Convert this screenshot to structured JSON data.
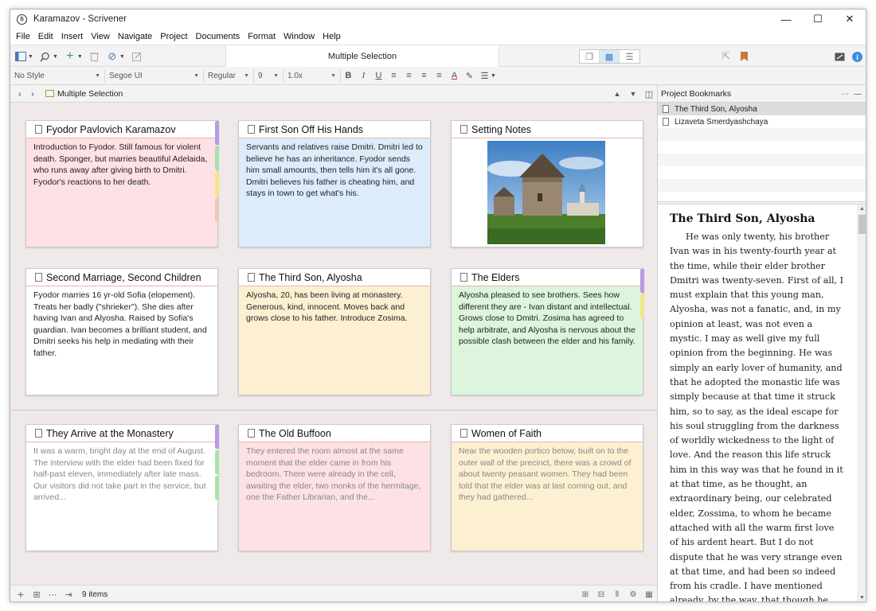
{
  "window": {
    "title": "Karamazov - Scrivener",
    "controls": {
      "minimize": "—",
      "maximize": "☐",
      "close": "✕"
    }
  },
  "menu": [
    "File",
    "Edit",
    "Insert",
    "View",
    "Navigate",
    "Project",
    "Documents",
    "Format",
    "Window",
    "Help"
  ],
  "toolbar": {
    "center_title": "Multiple Selection"
  },
  "format": {
    "style": "No Style",
    "font": "Segoe UI",
    "weight": "Regular",
    "size": "9",
    "spacing": "1.0x"
  },
  "breadcrumb": {
    "label": "Multiple Selection"
  },
  "cards": [
    {
      "title": "Fyodor Pavlovich  Karamazov",
      "body": "Introduction to Fyodor. Still famous for violent death. Sponger, but marries beautiful Adelaida, who runs away after giving birth to Dmitri. Fyodor's reactions to her death.",
      "color": "pink",
      "labels": [
        "#b89be0",
        "#a6e3a6",
        "#f4e58a",
        "#f0c9b5"
      ]
    },
    {
      "title": "First Son Off His Hands",
      "body": "Servants and relatives raise Dmitri. Dmitri led to believe he has an inheritance. Fyodor sends him small amounts, then tells him it's all gone. Dmitri believes his father is cheating him, and stays in town to get what's his.",
      "color": "blue",
      "labels": []
    },
    {
      "title": "Setting Notes",
      "body": "",
      "color": "white",
      "labels": []
    },
    {
      "title": "Second Marriage, Second Children",
      "body": "Fyodor marries 16 yr-old Sofia (elopement). Treats her badly (\"shrieker\"). She dies after having Ivan and Alyosha. Raised by Sofia's guardian. Ivan becomes a brilliant student, and Dmitri seeks his help in mediating with their father.",
      "color": "white",
      "labels": []
    },
    {
      "title": "The Third Son, Alyosha",
      "body": "Alyosha, 20, has been living at monastery. Generous, kind, innocent. Moves back and grows close to his father. Introduce Zosima.",
      "color": "yellow",
      "labels": []
    },
    {
      "title": "The Elders",
      "body": "Alyosha pleased to see brothers. Sees how different they are - Ivan distant and intellectual. Grows close to Dmitri. Zosima has agreed to help arbitrate, and Alyosha is nervous about the possible clash between the elder and his family.",
      "color": "green",
      "labels": [
        "#b89be0",
        "#f4e58a"
      ]
    },
    {
      "title": "They Arrive at the Monastery",
      "body": "It was a warm, bright day at the end of August. The interview with the elder had been fixed for half-past eleven, immediately after late mass. Our visitors did not take part in the service, but arrived...",
      "color": "white",
      "labels": [
        "#b89be0",
        "#a6e3a6",
        "#a6e3a6"
      ]
    },
    {
      "title": "The Old Buffoon",
      "body": "They entered the room almost at the same moment that the elder came in from his bedroom. There were already in the cell, awaiting the elder, two monks of the hermitage, one the Father Librarian, and the...",
      "color": "pink",
      "labels": []
    },
    {
      "title": "Women of Faith",
      "body": "Near the wooden portico below, built on to the outer wall of the precinct, there was a crowd of about twenty peasant women. They had been told that the elder was at last coming out, and they had gathered...",
      "color": "yellow",
      "labels": []
    }
  ],
  "status": {
    "count": "9 items"
  },
  "bookmarks": {
    "title": "Project Bookmarks",
    "items": [
      "The Third Son, Alyosha",
      "Lizaveta Smerdyashchaya"
    ]
  },
  "reader": {
    "title": "The Third Son, Alyosha",
    "text": "He was only twenty, his brother Ivan was in his twenty-fourth year at the time, while their elder brother Dmitri was twenty-seven. First of all, I must explain that this young man, Alyosha, was not a fanatic, and, in my opinion at least, was not even a mystic. I may as well give my full opinion from the beginning. He was simply an early lover of humanity, and that he adopted the monastic life was simply because at that time it struck him, so to say, as the ideal escape for his soul struggling from the darkness of worldly wickedness to the light of love. And the reason this life struck him in this way was that he found in it at that time, as he thought, an extraordinary being, our celebrated elder, Zossima, to whom he became attached with all the warm first love of his ardent heart. But I do not dispute that he was very strange even at that time, and had been so indeed from his cradle. I have mentioned already, by the way, that though he"
  },
  "colors": {
    "pink": "#fde1e4",
    "blue": "#dcecfa",
    "yellow": "#fdf0d2",
    "green": "#dcf5dc",
    "white": "#ffffff",
    "accent": "#3a7bc8"
  }
}
